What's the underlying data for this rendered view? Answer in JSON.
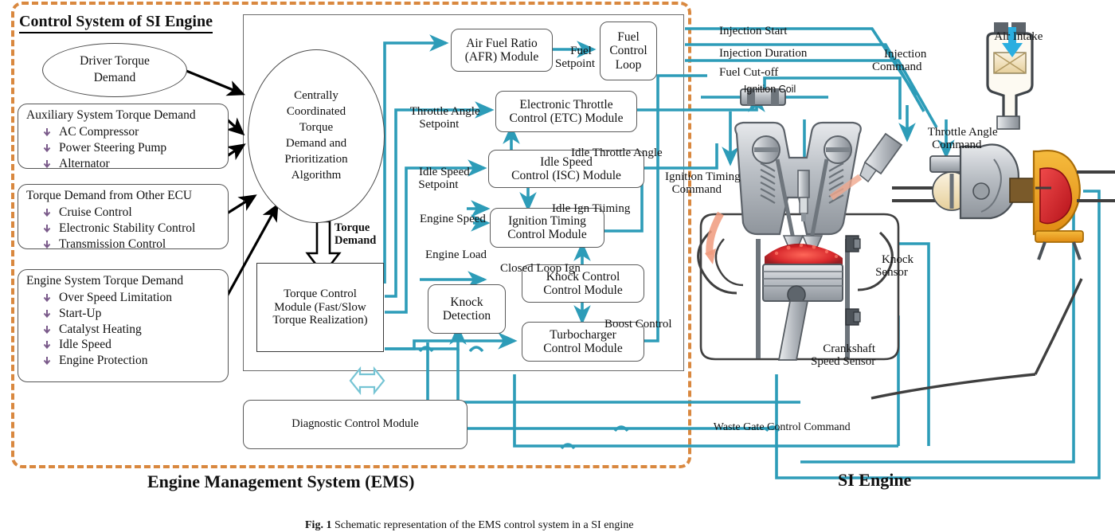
{
  "figure": {
    "caption_bold": "Fig. 1",
    "caption_text": "Schematic representation of the EMS control system in a SI engine"
  },
  "colors": {
    "wire_teal": "#2d9cb8",
    "ems_boundary_orange": "#d9883f",
    "box_border_gray": "#5a5a5a",
    "arrow_black": "#000000",
    "engine_gray": "#9aa0a6",
    "turbo_orange": "#e8a317",
    "turbo_red": "#d31f26"
  },
  "titles": {
    "control_system": "Control System of SI Engine",
    "ems": "Engine Management System (EMS)",
    "si_engine": "SI Engine"
  },
  "left_inputs": {
    "driver": {
      "name": "driver-torque-demand",
      "line1": "Driver Torque",
      "line2": "Demand"
    },
    "groups": [
      {
        "name": "auxiliary-system-torque-demand",
        "header": "Auxiliary System Torque Demand",
        "items": [
          "AC Compressor",
          "Power Steering Pump",
          "Alternator"
        ]
      },
      {
        "name": "torque-demand-other-ecu",
        "header": "Torque Demand from Other ECU",
        "items": [
          "Cruise Control",
          "Electronic Stability Control",
          "Transmission Control"
        ]
      },
      {
        "name": "engine-system-torque-demand",
        "header": "Engine System Torque Demand",
        "items": [
          "Over Speed Limitation",
          "Start-Up",
          "Catalyst Heating",
          "Idle Speed",
          "Engine Protection"
        ]
      }
    ]
  },
  "central": {
    "algorithm_ellipse": "Centrally\nCoordinated\nTorque\nDemand and\nPrioritization\nAlgorithm",
    "torque_demand_arrow_label": "Torque\nDemand",
    "torque_control_module": "Torque Control\nModule (Fast/Slow\nTorque Realization)",
    "diagnostic_control_module": "Diagnostic Control Module"
  },
  "modules": [
    {
      "name": "afr-module",
      "label": "Air Fuel Ratio\n(AFR) Module"
    },
    {
      "name": "fuel-control-loop",
      "label": "Fuel\nControl\nLoop"
    },
    {
      "name": "etc-module",
      "label": "Electronic Throttle\nControl (ETC) Module"
    },
    {
      "name": "isc-module",
      "label": "Idle Speed\nControl (ISC) Module"
    },
    {
      "name": "ignition-timing-module",
      "label": "Ignition Timing\nControl Module"
    },
    {
      "name": "knock-detection",
      "label": "Knock\nDetection"
    },
    {
      "name": "knock-control-module",
      "label": "Knock Control\nControl Module"
    },
    {
      "name": "turbocharger-module",
      "label": "Turbocharger\nControl Module"
    }
  ],
  "signal_labels": {
    "fuel_setpoint": "Fuel\nSetpoint",
    "throttle_angle_setpoint": "Throttle Angle\nSetpoint",
    "idle_throttle_angle": "Idle Throttle Angle",
    "idle_speed_setpoint": "Idle Speed\nSetpoint",
    "idle_ign_timing": "Idle Ign Tiiming",
    "engine_speed": "Engine Speed",
    "engine_load": "Engine Load",
    "closed_loop_ign": "Closed Loop Ign",
    "boost_control": "Boost Control"
  },
  "engine_labels": {
    "injection_start": "Injection Start",
    "injection_duration": "Injection Duration",
    "fuel_cut_off": "Fuel Cut-off",
    "injection_command": "Injection\nCommand",
    "ignition_coil": "Ignition Coil",
    "ignition_timing_command": "Ignition Timing\nCommand",
    "throttle_angle_command": "Throttle Angle\nCommand",
    "air_intake": "Air Intake",
    "knock_sensor": "Knock\nSensor",
    "crankshaft_speed_sensor": "Crankshaft\nSpeed Sensor",
    "waste_gate_control_command": "Waste Gate Control Command"
  }
}
